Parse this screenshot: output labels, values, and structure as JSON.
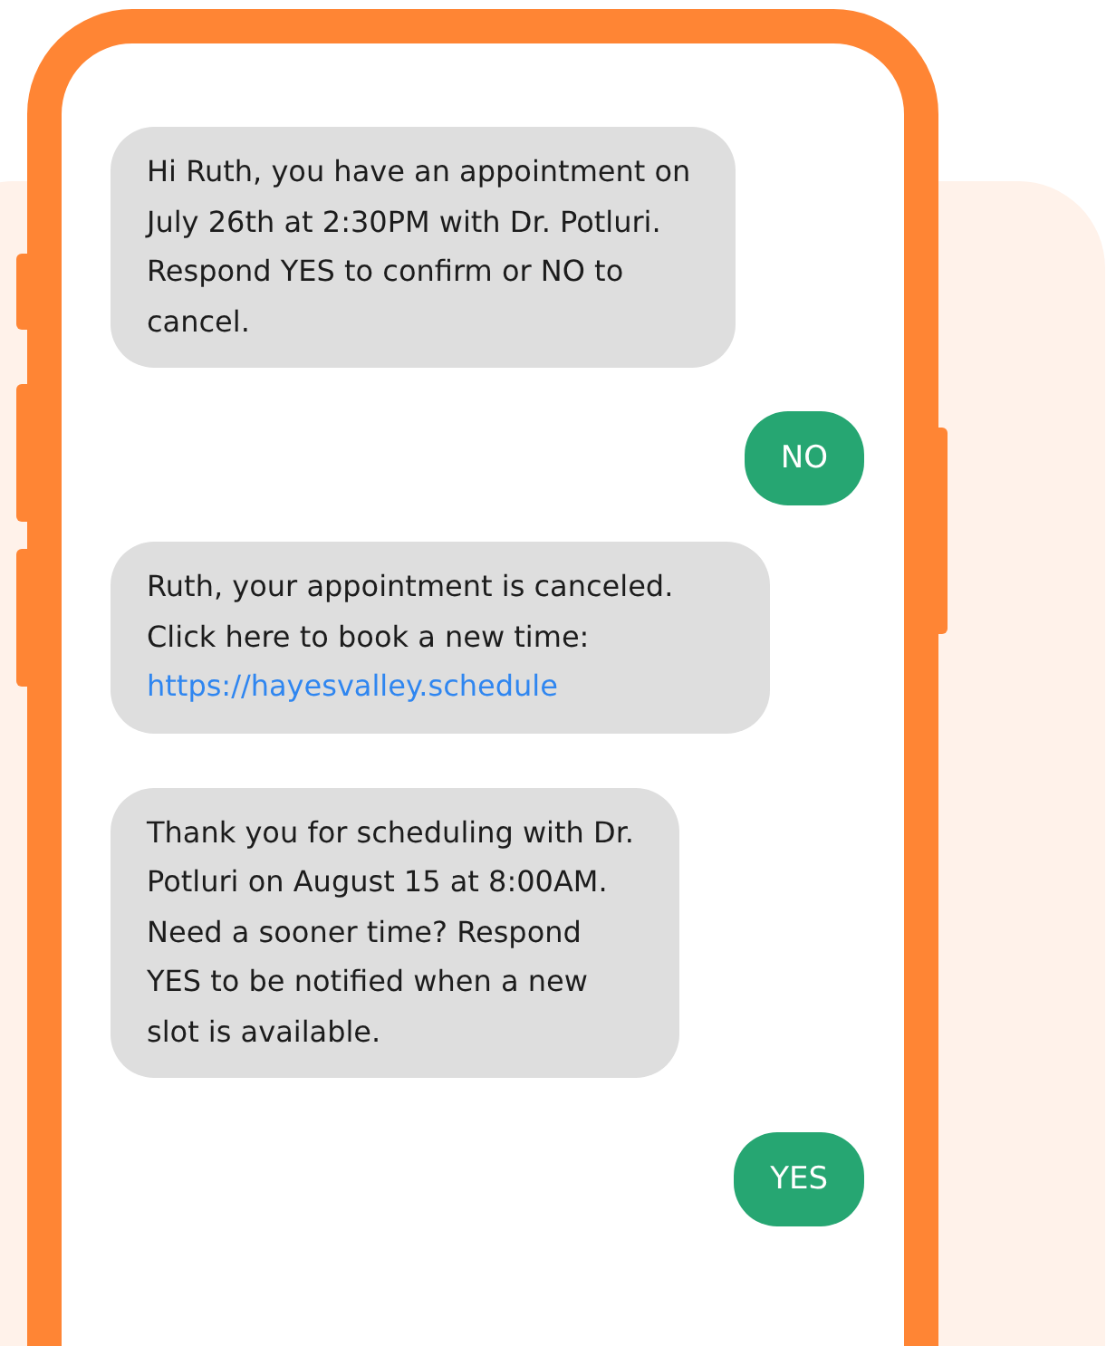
{
  "messages": [
    {
      "kind": "incoming",
      "text": "Hi Ruth, you have an appointment on July 26th at 2:30PM with Dr. Potluri. Respond YES to confirm or NO to cancel."
    },
    {
      "kind": "outgoing",
      "text": "NO"
    },
    {
      "kind": "incoming",
      "text": "Ruth, your appointment is canceled. Click here to book a new time:",
      "link": "https://hayesvalley.schedule"
    },
    {
      "kind": "incoming",
      "text": "Thank you for scheduling with Dr. Potluri on August 15 at 8:00AM. Need a sooner time? Respond YES to be notified when a new slot is available."
    },
    {
      "kind": "outgoing",
      "text": "YES"
    }
  ]
}
